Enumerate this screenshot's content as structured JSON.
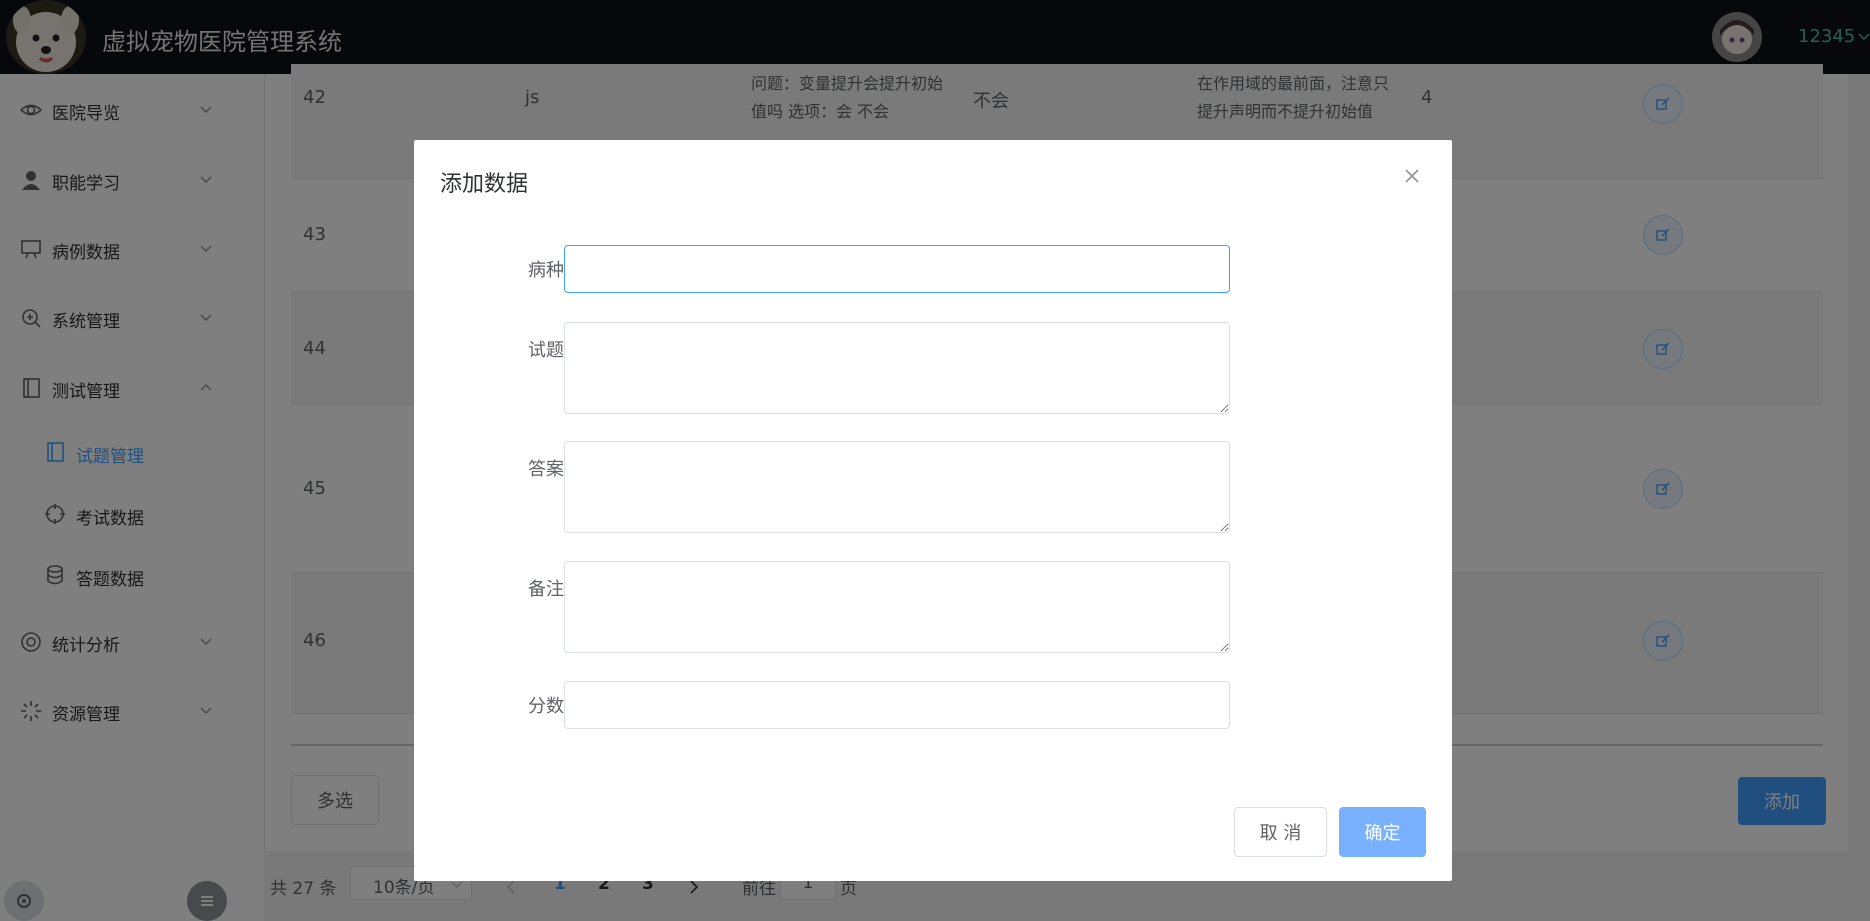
{
  "header": {
    "title": "虚拟宠物医院管理系统",
    "username": "12345"
  },
  "sidebar": {
    "items": [
      {
        "label": "医院导览",
        "icon": "eye-icon"
      },
      {
        "label": "职能学习",
        "icon": "user-icon"
      },
      {
        "label": "病例数据",
        "icon": "presentation-icon"
      },
      {
        "label": "系统管理",
        "icon": "zoom-icon"
      },
      {
        "label": "测试管理",
        "icon": "notebook-icon"
      },
      {
        "label": "统计分析",
        "icon": "lifebuoy-icon"
      },
      {
        "label": "资源管理",
        "icon": "loading-icon"
      }
    ],
    "subitems": [
      {
        "label": "试题管理",
        "icon": "notebook-icon",
        "active": true
      },
      {
        "label": "考试数据",
        "icon": "target-icon",
        "active": false
      },
      {
        "label": "答题数据",
        "icon": "database-icon",
        "active": false
      }
    ]
  },
  "table": {
    "rows": [
      {
        "id": "42",
        "type": "js",
        "question": "问题：变量提升会提升初始值吗 选项：会 不会",
        "answer": "不会",
        "note": "在作用域的最前面，注意只提升声明而不提升初始值",
        "score": "4"
      },
      {
        "id": "43"
      },
      {
        "id": "44"
      },
      {
        "id": "45"
      },
      {
        "id": "46"
      }
    ]
  },
  "toolbar": {
    "multi_select": "多选",
    "add": "添加"
  },
  "pagination": {
    "total": "共 27 条",
    "page_size": "10条/页",
    "pages": [
      "1",
      "2",
      "3"
    ],
    "current": "1",
    "goto_prefix": "前往",
    "goto_value": "1",
    "goto_suffix": "页"
  },
  "dialog": {
    "title": "添加数据",
    "fields": {
      "disease": "病种",
      "question": "试题",
      "answer": "答案",
      "note": "备注",
      "score": "分数"
    },
    "cancel": "取 消",
    "confirm": "确定"
  },
  "colors": {
    "accent": "#409eff",
    "header_bg": "#0f1016",
    "username": "#4fc3a1"
  }
}
